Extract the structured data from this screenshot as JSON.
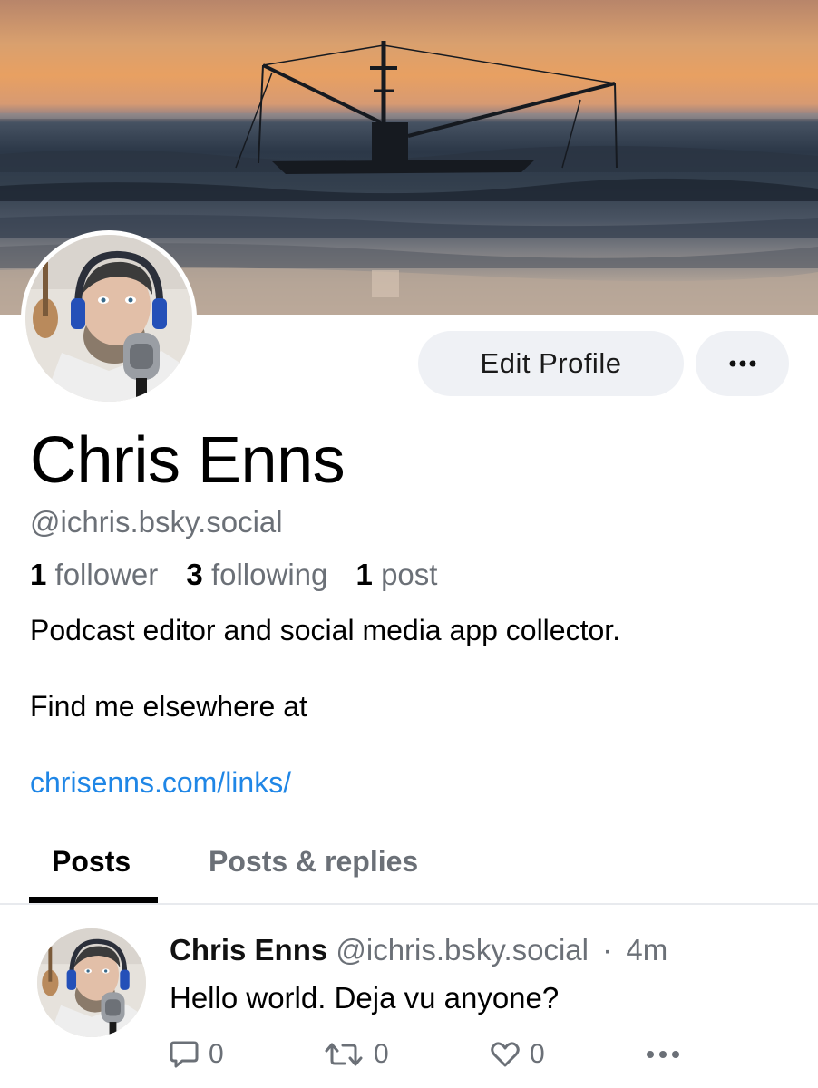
{
  "banner": {
    "icon": "banner-image"
  },
  "profile": {
    "display_name": "Chris Enns",
    "handle": "@ichris.bsky.social",
    "stats": {
      "followers_count": "1",
      "followers_label": "follower",
      "following_count": "3",
      "following_label": "following",
      "posts_count": "1",
      "posts_label": "post"
    },
    "bio": {
      "line1": "Podcast editor and social media app collector.",
      "line2": "Find me elsewhere at",
      "link": "chrisenns.com/links/"
    }
  },
  "actions": {
    "edit_profile": "Edit Profile",
    "more_icon": "more-horizontal-icon"
  },
  "tabs": [
    {
      "label": "Posts",
      "active": true
    },
    {
      "label": "Posts & replies",
      "active": false
    }
  ],
  "post": {
    "author_name": "Chris Enns",
    "author_handle": "@ichris.bsky.social",
    "separator": "·",
    "time": "4m",
    "text": "Hello world. Deja vu anyone?",
    "reply_count": "0",
    "repost_count": "0",
    "like_count": "0"
  },
  "colors": {
    "link": "#1f86e6",
    "muted": "#6b7077",
    "button_bg": "#eff1f5"
  }
}
